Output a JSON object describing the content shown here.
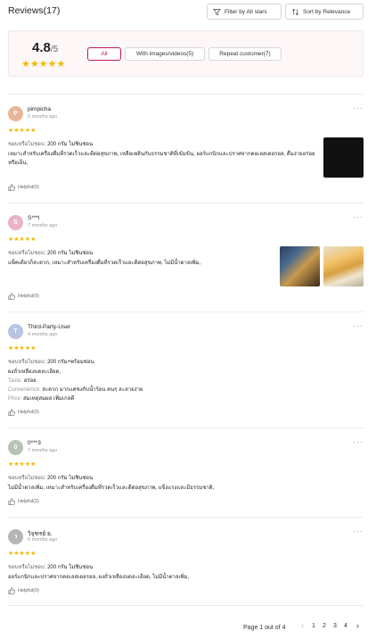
{
  "header": {
    "title": "Reviews(17)",
    "filter_label": "Filter by All stars",
    "sort_label": "Sort by Relevance"
  },
  "summary": {
    "score": "4.8",
    "score_max": "/5",
    "stars": "★★★★★",
    "chips": [
      {
        "label": "All",
        "active": true
      },
      {
        "label": "With images/videos(5)",
        "active": false
      },
      {
        "label": "Repeat customer(7)",
        "active": false
      }
    ]
  },
  "reviews": [
    {
      "initial": "P",
      "avatar_color": "#e7b596",
      "name": "pimpicha",
      "date": "6 months ago",
      "stars": "★★★★★",
      "rating": 5,
      "variant_key": "ชอบหรือไม่ชอบ:",
      "variant_value": "200 กรัม ไม่ชินช่อน",
      "text": "เหมาะสำหรับเครื่องดื่มที่รวดเร็วและดีต่อสุขภาพ, เหลือเพลินกับธรรมชาติที่เข้มข้น, ออร์แกนิกและปราศจากคอเลสเตอรอล, ดื่มง่ายอร่อยหรือเย็น,",
      "helpful": "Helpful(0)"
    },
    {
      "initial": "S",
      "avatar_color": "#eab2c6",
      "name": "S***l",
      "date": "7 months ago",
      "stars": "★★★★★",
      "rating": 5,
      "variant_key": "ชอบหรือไม่ชอบ:",
      "variant_value": "200 กรัม ไม่ชินช่อน",
      "text": "แพ็คเดียวก็สะดวก, เหมาะสำหรับเครื่องดื่มที่รวดเร็วและดีต่อสุขภาพ, ไม่มีน้ำตาลเพิ่ม,",
      "helpful": "Helpful(0)"
    },
    {
      "initial": "T",
      "avatar_color": "#b9c3e4",
      "name": "Third-Party-User",
      "date": "4 months ago",
      "stars": "★★★★★",
      "rating": 5,
      "variant_key": "ชอบหรือไม่ชอบ:",
      "variant_value": "200 กรัม+พร้อมช่อน",
      "text": "ผงถั่วเหลืองบดละเอียด,",
      "attributes": [
        {
          "key": "Taste:",
          "value": "อร่อย"
        },
        {
          "key": "Convenience:",
          "value": "สะดวก มากแค่ชงกับน้ำร้อน คนๆ ละลายง่าย"
        },
        {
          "key": "Price:",
          "value": "สมเหตุสมผล เพิ่มเกลดี"
        }
      ],
      "helpful": "Helpful(0)"
    },
    {
      "initial": "0",
      "avatar_color": "#b8c2b6",
      "name": "0***3",
      "date": "7 months ago",
      "stars": "★★★★★",
      "rating": 5,
      "variant_key": "ชอบหรือไม่ชอบ:",
      "variant_value": "200 กรัม ไม่ชินช่อน",
      "text": "ไม่มีน้ำตาลเพิ่ม, เหมาะสำหรับเครื่องดื่มที่รวดเร็วและดีต่อสุขภาพ, แข็งแรงและมีธรรมชาติ,",
      "helpful": "Helpful(2)"
    },
    {
      "initial": "ว",
      "avatar_color": "#b5b5b5",
      "name": "วิจุฑรย์ ย.",
      "date": "6 months ago",
      "stars": "★★★★★",
      "rating": 5,
      "variant_key": "ชอบหรือไม่ชอบ:",
      "variant_value": "200 กรัม ไม่ชินช่อน",
      "text": "ออร์แกนิกและปราศจากคอเลสเตอรอล, ผงถั่วเหลืองบดละเอียด, ไม่มีน้ำตาลเพิ่ม,",
      "helpful": "Helpful(0)"
    }
  ],
  "pagination": {
    "label": "Page 1 out of 4",
    "prev": "‹",
    "pages": [
      "1",
      "2",
      "3",
      "4"
    ],
    "next": "›",
    "current": "1"
  },
  "colors": {
    "accent": "#c2185b",
    "star": "#f5b800"
  },
  "icons": {
    "filter": "filter-icon",
    "sort": "sort-icon",
    "more": "more-icon",
    "thumb_up": "thumb-up-icon"
  }
}
